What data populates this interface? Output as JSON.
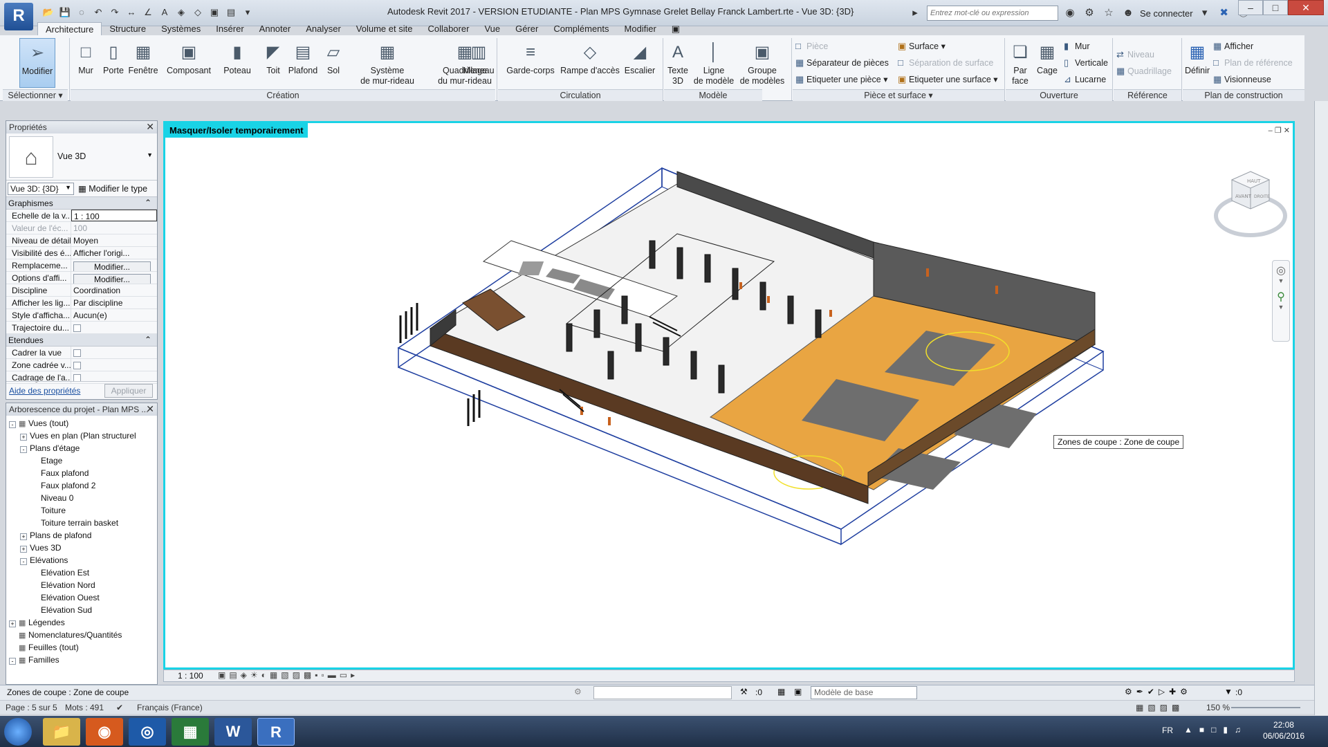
{
  "window": {
    "title": "Autodesk Revit 2017 - VERSION ETUDIANTE -     Plan MPS Gymnase Grelet Bellay Franck Lambert.rte - Vue 3D: {3D}",
    "app_letter": "R",
    "search_placeholder": "Entrez mot-clé ou expression",
    "sign_in": "Se connecter"
  },
  "tabs": [
    "Architecture",
    "Structure",
    "Systèmes",
    "Insérer",
    "Annoter",
    "Analyser",
    "Volume et site",
    "Collaborer",
    "Vue",
    "Gérer",
    "Compléments",
    "Modifier"
  ],
  "ribbon": {
    "select": {
      "modify": "Modifier",
      "label": "Sélectionner"
    },
    "creation": {
      "label": "Création",
      "buttons": [
        "Mur",
        "Porte",
        "Fenêtre",
        "Composant",
        "Poteau",
        "Toit",
        "Plafond",
        "Sol",
        "Système\nde mur-rideau",
        "Quadrillage\ndu mur-rideau",
        "Meneau"
      ]
    },
    "circulation": {
      "label": "Circulation",
      "buttons": [
        "Garde-corps",
        "Rampe d'accès",
        "Escalier"
      ]
    },
    "model": {
      "label": "Modèle",
      "buttons": [
        "Texte\n3D",
        "Ligne\nde modèle",
        "Groupe\nde modèles"
      ]
    },
    "room": {
      "label": "Pièce et surface",
      "items": [
        "Pièce",
        "Séparateur de pièces",
        "Etiqueter une pièce",
        "Surface",
        "Séparation de surface",
        "Etiqueter une surface"
      ]
    },
    "opening": {
      "label": "Ouverture",
      "face": "Par\nface",
      "shaft": "Cage",
      "items": [
        "Mur",
        "Verticale",
        "Lucarne"
      ]
    },
    "datum": {
      "label": "Référence",
      "items": [
        "Niveau",
        "Quadrillage"
      ]
    },
    "workplane": {
      "label": "Plan de construction",
      "define": "Définir",
      "items": [
        "Afficher",
        "Plan de référence",
        "Visionneuse"
      ]
    }
  },
  "properties": {
    "title": "Propriétés",
    "type_name": "Vue 3D",
    "view_selector": "Vue 3D: {3D}",
    "edit_type": "Modifier le type",
    "groups": [
      {
        "name": "Graphismes",
        "rows": [
          {
            "k": "Echelle de la v...",
            "v": "1 : 100"
          },
          {
            "k": "Valeur de l'éc...",
            "v": "100"
          },
          {
            "k": "Niveau de détail",
            "v": "Moyen"
          },
          {
            "k": "Visibilité des é...",
            "v": "Afficher l'origi..."
          },
          {
            "k": "Remplaceme...",
            "v": "Modifier..."
          },
          {
            "k": "Options d'affi...",
            "v": "Modifier..."
          },
          {
            "k": "Discipline",
            "v": "Coordination"
          },
          {
            "k": "Afficher les lig...",
            "v": "Par discipline"
          },
          {
            "k": "Style d'afficha...",
            "v": "Aucun(e)"
          },
          {
            "k": "Trajectoire du...",
            "v": ""
          }
        ]
      },
      {
        "name": "Etendues",
        "rows": [
          {
            "k": "Cadrer la vue",
            "v": ""
          },
          {
            "k": "Zone cadrée v...",
            "v": ""
          },
          {
            "k": "Cadrage de l'a...",
            "v": ""
          }
        ]
      }
    ],
    "help": "Aide des propriétés",
    "apply": "Appliquer"
  },
  "browser": {
    "title": "Arborescence du projet - Plan MPS ...",
    "nodes": [
      {
        "label": "Vues (tout)",
        "level": 0,
        "exp": "-"
      },
      {
        "label": "Vues en plan (Plan structurel",
        "level": 1,
        "exp": "+"
      },
      {
        "label": "Plans d'étage",
        "level": 1,
        "exp": "-"
      },
      {
        "label": "Etage",
        "level": 2,
        "exp": ""
      },
      {
        "label": "Faux plafond",
        "level": 2,
        "exp": ""
      },
      {
        "label": "Faux plafond 2",
        "level": 2,
        "exp": ""
      },
      {
        "label": "Niveau 0",
        "level": 2,
        "exp": ""
      },
      {
        "label": "Toiture",
        "level": 2,
        "exp": ""
      },
      {
        "label": "Toiture terrain basket",
        "level": 2,
        "exp": ""
      },
      {
        "label": "Plans de plafond",
        "level": 1,
        "exp": "+"
      },
      {
        "label": "Vues 3D",
        "level": 1,
        "exp": "+"
      },
      {
        "label": "Elévations",
        "level": 1,
        "exp": "-"
      },
      {
        "label": "Elévation Est",
        "level": 2,
        "exp": ""
      },
      {
        "label": "Elévation Nord",
        "level": 2,
        "exp": ""
      },
      {
        "label": "Elévation Ouest",
        "level": 2,
        "exp": ""
      },
      {
        "label": "Elévation Sud",
        "level": 2,
        "exp": ""
      },
      {
        "label": "Légendes",
        "level": 0,
        "exp": "+"
      },
      {
        "label": "Nomenclatures/Quantités",
        "level": 0,
        "exp": ""
      },
      {
        "label": "Feuilles (tout)",
        "level": 0,
        "exp": ""
      },
      {
        "label": "Familles",
        "level": 0,
        "exp": "-"
      }
    ]
  },
  "view": {
    "isolate_label": "Masquer/Isoler temporairement",
    "tooltip": "Zones de coupe : Zone de coupe",
    "viewcube_top": "HAUT",
    "viewcube_front": "AVANT",
    "viewcube_right": "DROITE",
    "scale": "1 : 100"
  },
  "status": {
    "text": "Zones de coupe : Zone de coupe",
    "zero_left": ":0",
    "zero_right": ":0",
    "model": "Modèle de base",
    "page": "Page : 5 sur 5",
    "words": "Mots : 491",
    "language": "Français (France)",
    "zoom": "150 %"
  },
  "taskbar": {
    "lang": "FR",
    "time": "22:08",
    "date": "06/06/2016",
    "apps": [
      "start",
      "explorer",
      "firefox",
      "browser-2",
      "libreoffice",
      "W",
      "R"
    ]
  }
}
